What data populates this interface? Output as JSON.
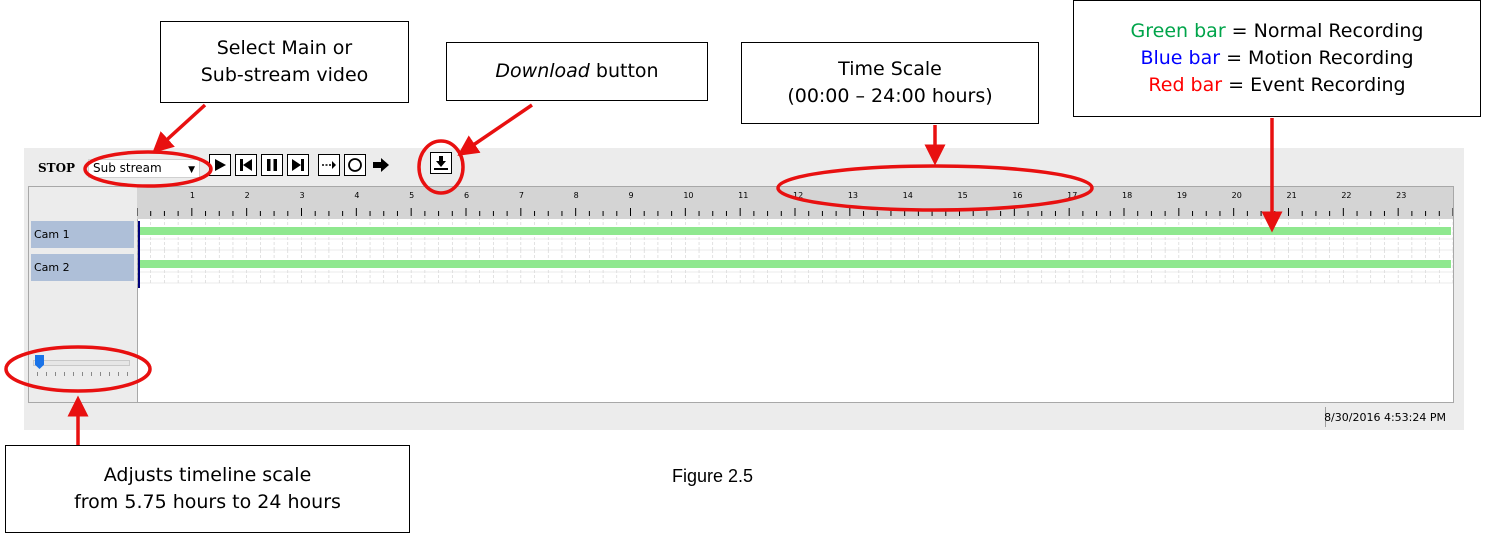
{
  "callouts": {
    "stream": {
      "line1": "Select Main or",
      "line2": "Sub-stream video"
    },
    "download": {
      "italic": "Download",
      "rest": " button"
    },
    "time_scale": {
      "line1": "Time Scale",
      "line2": "(00:00 – 24:00 hours)"
    },
    "legend": [
      {
        "colored": "Green bar",
        "rest": " = Normal Recording",
        "color": "#00a44a"
      },
      {
        "colored": "Blue bar",
        "rest": " = Motion Recording",
        "color": "#0000ff"
      },
      {
        "colored": "Red bar",
        "rest": " = Event Recording",
        "color": "#ff0000"
      }
    ],
    "scale": {
      "line1": "Adjusts timeline scale",
      "line2": "from 5.75 hours to 24 hours"
    }
  },
  "figure_caption": "Figure 2.5",
  "toolbar": {
    "stop_label": "STOP",
    "stream_select_value": "Sub stream",
    "buttons": [
      "play-icon",
      "skip-back-icon",
      "pause-icon",
      "skip-forward-icon",
      "step-arrow-icon",
      "record-icon",
      "arrow-right-icon",
      "download-icon"
    ]
  },
  "timeline": {
    "hour_labels": [
      "1",
      "2",
      "3",
      "4",
      "5",
      "6",
      "7",
      "8",
      "9",
      "10",
      "11",
      "12",
      "13",
      "14",
      "15",
      "16",
      "17",
      "18",
      "19",
      "20",
      "21",
      "22",
      "23"
    ],
    "cameras": [
      {
        "label": "Cam 1",
        "recording": "normal"
      },
      {
        "label": "Cam 2",
        "recording": "normal"
      }
    ],
    "recording_color": "#8fe88f",
    "zoom_slider_value": 0
  },
  "status": {
    "datetime": "8/30/2016 4:53:24 PM"
  },
  "colors": {
    "annotation_red": "#e81010",
    "cam_label_bg": "#aebfd8"
  }
}
